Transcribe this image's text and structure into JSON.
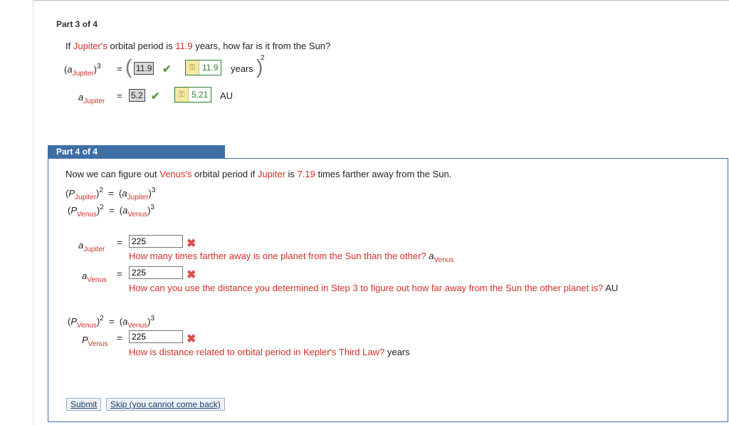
{
  "part3": {
    "heading": "Part 3 of 4",
    "question_pre": "If ",
    "question_planet": "Jupiter's",
    "question_mid": " orbital period is ",
    "question_value": "11.9",
    "question_post": " years, how far is it from the Sun?",
    "eq1": {
      "lhs_var": "a",
      "lhs_sub": "Jupiter",
      "lhs_exp": "3",
      "equals": "=",
      "input_value": "11.9",
      "key_value": "11.9",
      "unit": "years",
      "outer_exp": "2"
    },
    "eq2": {
      "lhs_var": "a",
      "lhs_sub": "Jupiter",
      "equals": "=",
      "input_value": "5.2",
      "key_value": "5.21",
      "unit": "AU"
    }
  },
  "part4": {
    "heading": "Part 4 of 4",
    "intro_pre": "Now we can figure out ",
    "intro_planet1": "Venus's",
    "intro_mid": " orbital period if ",
    "intro_planet2": "Jupiter",
    "intro_mid2": " is ",
    "intro_value": "7.19",
    "intro_post": " times farther away from the Sun.",
    "rel1": {
      "p": "P",
      "p_sub": "Jupiter",
      "p_exp": "2",
      "eq": "=",
      "a": "a",
      "a_sub": "Jupiter",
      "a_exp": "3"
    },
    "rel2": {
      "p": "P",
      "p_sub": "Venus",
      "p_exp": "2",
      "eq": "=",
      "a": "a",
      "a_sub": "Venus",
      "a_exp": "3"
    },
    "q1": {
      "var": "a",
      "sub": "Jupiter",
      "eq": "=",
      "value": "225",
      "hint": "How many times farther away is one planet from the Sun than the other?",
      "hint_unit_var": "a",
      "hint_unit_sub": "Venus"
    },
    "q2": {
      "var": "a",
      "sub": "Venus",
      "eq": "=",
      "value": "225",
      "hint": "How can you use the distance you determined in Step 3 to figure out how far away from the Sun the other planet is?",
      "unit": "AU"
    },
    "rel3": {
      "p": "P",
      "p_sub": "Venus",
      "p_exp": "2",
      "eq": "=",
      "a": "a",
      "a_sub": "Venus",
      "a_exp": "3"
    },
    "q3": {
      "var": "P",
      "sub": "Venus",
      "eq": "=",
      "value": "225",
      "hint": "How is distance related to orbital period in Kepler's Third Law?",
      "unit": "years"
    },
    "submit_label": "Submit",
    "skip_label": "Skip (you cannot come back)"
  },
  "icons": {
    "check": "check-icon",
    "x": "x-icon",
    "key": "key-icon"
  },
  "colors": {
    "accent": "#3e6fa5",
    "error": "#d0302a",
    "correct": "#2e7d32"
  }
}
